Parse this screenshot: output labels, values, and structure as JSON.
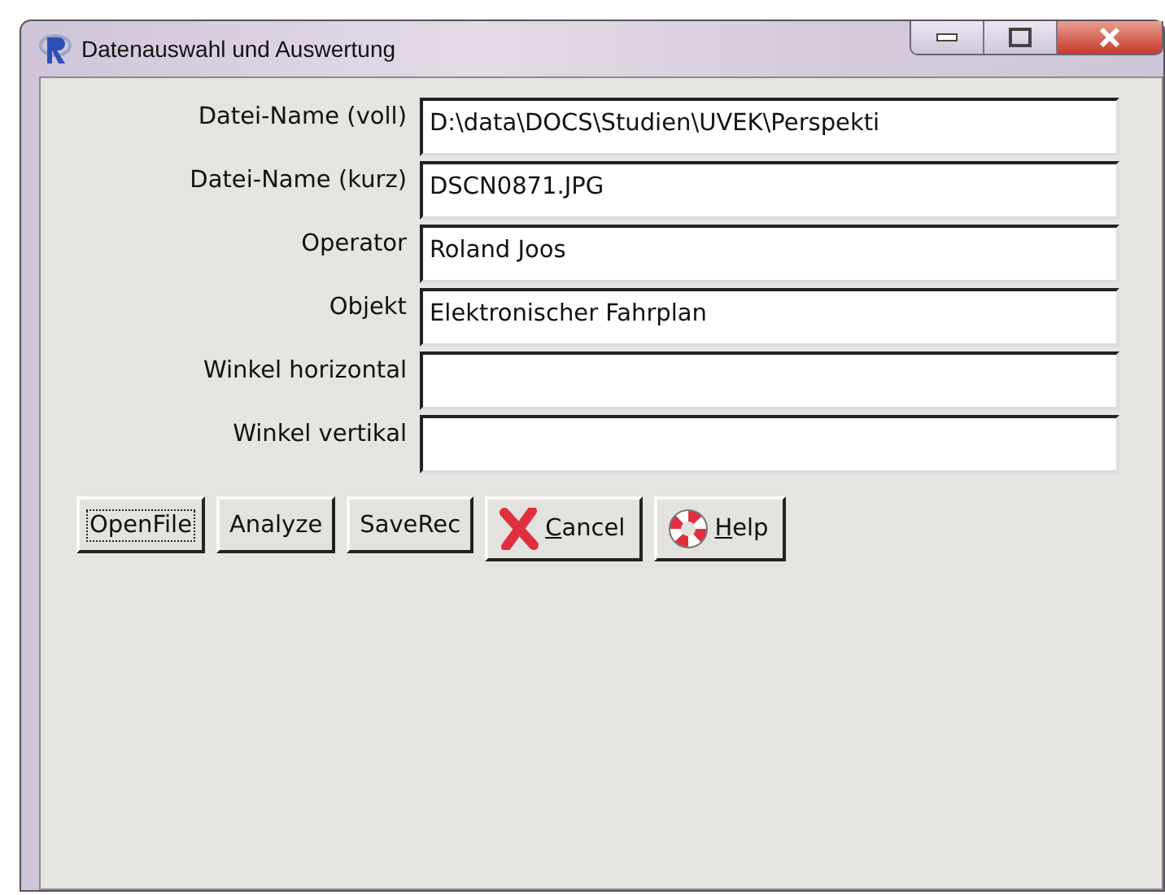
{
  "window": {
    "title": "Datenauswahl und Auswertung"
  },
  "fields": [
    {
      "label": "Datei-Name (voll)",
      "value": "D:\\data\\DOCS\\Studien\\UVEK\\Perspekti"
    },
    {
      "label": "Datei-Name (kurz)",
      "value": "DSCN0871.JPG"
    },
    {
      "label": "Operator",
      "value": "Roland Joos"
    },
    {
      "label": "Objekt",
      "value": "Elektronischer Fahrplan"
    },
    {
      "label": "Winkel horizontal"
    },
    {
      "label": "Winkel vertikal"
    }
  ],
  "buttons": [
    {
      "label": "OpenFile",
      "focused": true,
      "kind": "plain",
      "underline_first": false
    },
    {
      "label": "Analyze",
      "focused": false,
      "kind": "plain",
      "underline_first": false
    },
    {
      "label": "SaveRec",
      "focused": false,
      "kind": "plain",
      "underline_first": false
    },
    {
      "label": "Cancel",
      "focused": false,
      "kind": "cancel",
      "underline_first": true
    },
    {
      "label": "Help",
      "focused": false,
      "kind": "help",
      "underline_first": true
    }
  ]
}
